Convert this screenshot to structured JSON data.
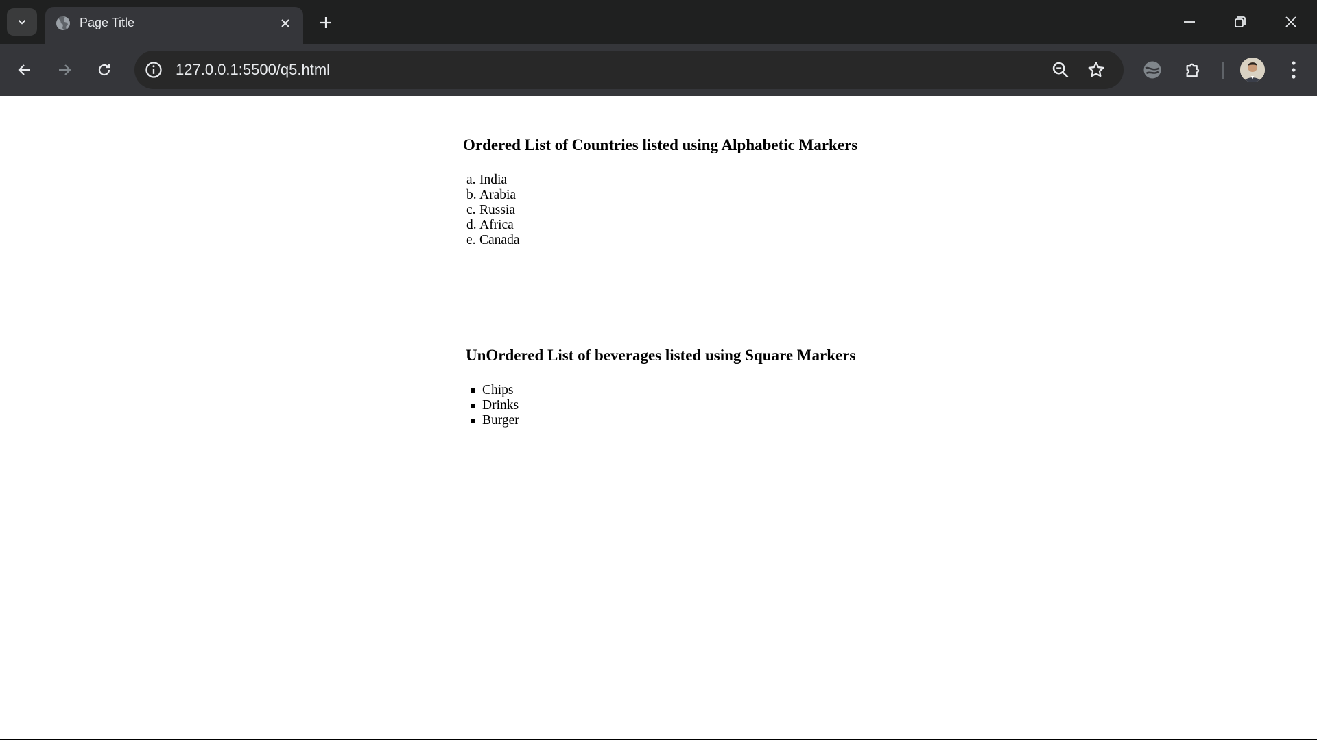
{
  "browser": {
    "tab_title": "Page Title",
    "url": "127.0.0.1:5500/q5.html",
    "accent": "#35363a"
  },
  "icons": [
    "chevron-down-icon",
    "globe-icon",
    "close-icon",
    "plus-icon",
    "minimize-icon",
    "restore-icon",
    "close-window-icon",
    "back-icon",
    "forward-icon",
    "reload-icon",
    "info-icon",
    "zoom-icon",
    "star-icon",
    "extension-icon",
    "puzzle-icon",
    "avatar",
    "more-vert-icon"
  ],
  "page": {
    "ordered_heading": "Ordered List of Countries listed using Alphabetic Markers",
    "countries": [
      {
        "marker": "a.",
        "name": "India"
      },
      {
        "marker": "b.",
        "name": "Arabia"
      },
      {
        "marker": "c.",
        "name": "Russia"
      },
      {
        "marker": "d.",
        "name": "Africa"
      },
      {
        "marker": "e.",
        "name": "Canada"
      }
    ],
    "unordered_heading": "UnOrdered List of beverages listed using Square Markers",
    "beverages": [
      "Chips",
      "Drinks",
      "Burger"
    ]
  }
}
